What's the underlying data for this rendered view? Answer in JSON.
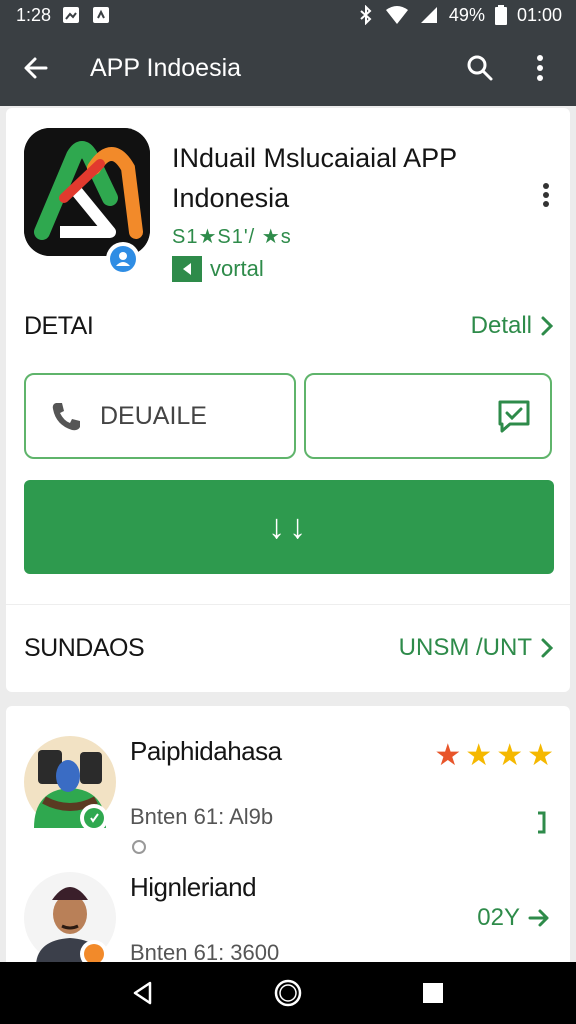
{
  "status_bar": {
    "time": "1:28",
    "battery": "49%",
    "clock_right": "01:00"
  },
  "app_bar": {
    "title": "APP Indoesia",
    "back_icon": "arrow-back-icon",
    "search_icon": "search-icon",
    "more_icon": "more-vert-icon"
  },
  "app": {
    "name": "INduail Mslucaiaial APP Indonesia",
    "rating_text": "S1★S1'/ ★s",
    "tag": "vortal"
  },
  "details": {
    "title": "DETAI",
    "link": "Detall",
    "call_label": "DEUAILE"
  },
  "install": {
    "label": "↓↓"
  },
  "reviews_header": {
    "title": "SUNDAOS",
    "link": "UNSM /UNT"
  },
  "reviews": [
    {
      "name": "Paiphidahasa",
      "meta": "Bnten 61: Al9b",
      "stars": 4,
      "action": ""
    },
    {
      "name": "Hignleriand",
      "meta": "Bnten 61: 3600",
      "action": "02Y"
    }
  ],
  "colors": {
    "accent": "#2e9a4e",
    "appbar": "#3a3f43",
    "star_first": "#e8552a",
    "star": "#f5b800"
  }
}
